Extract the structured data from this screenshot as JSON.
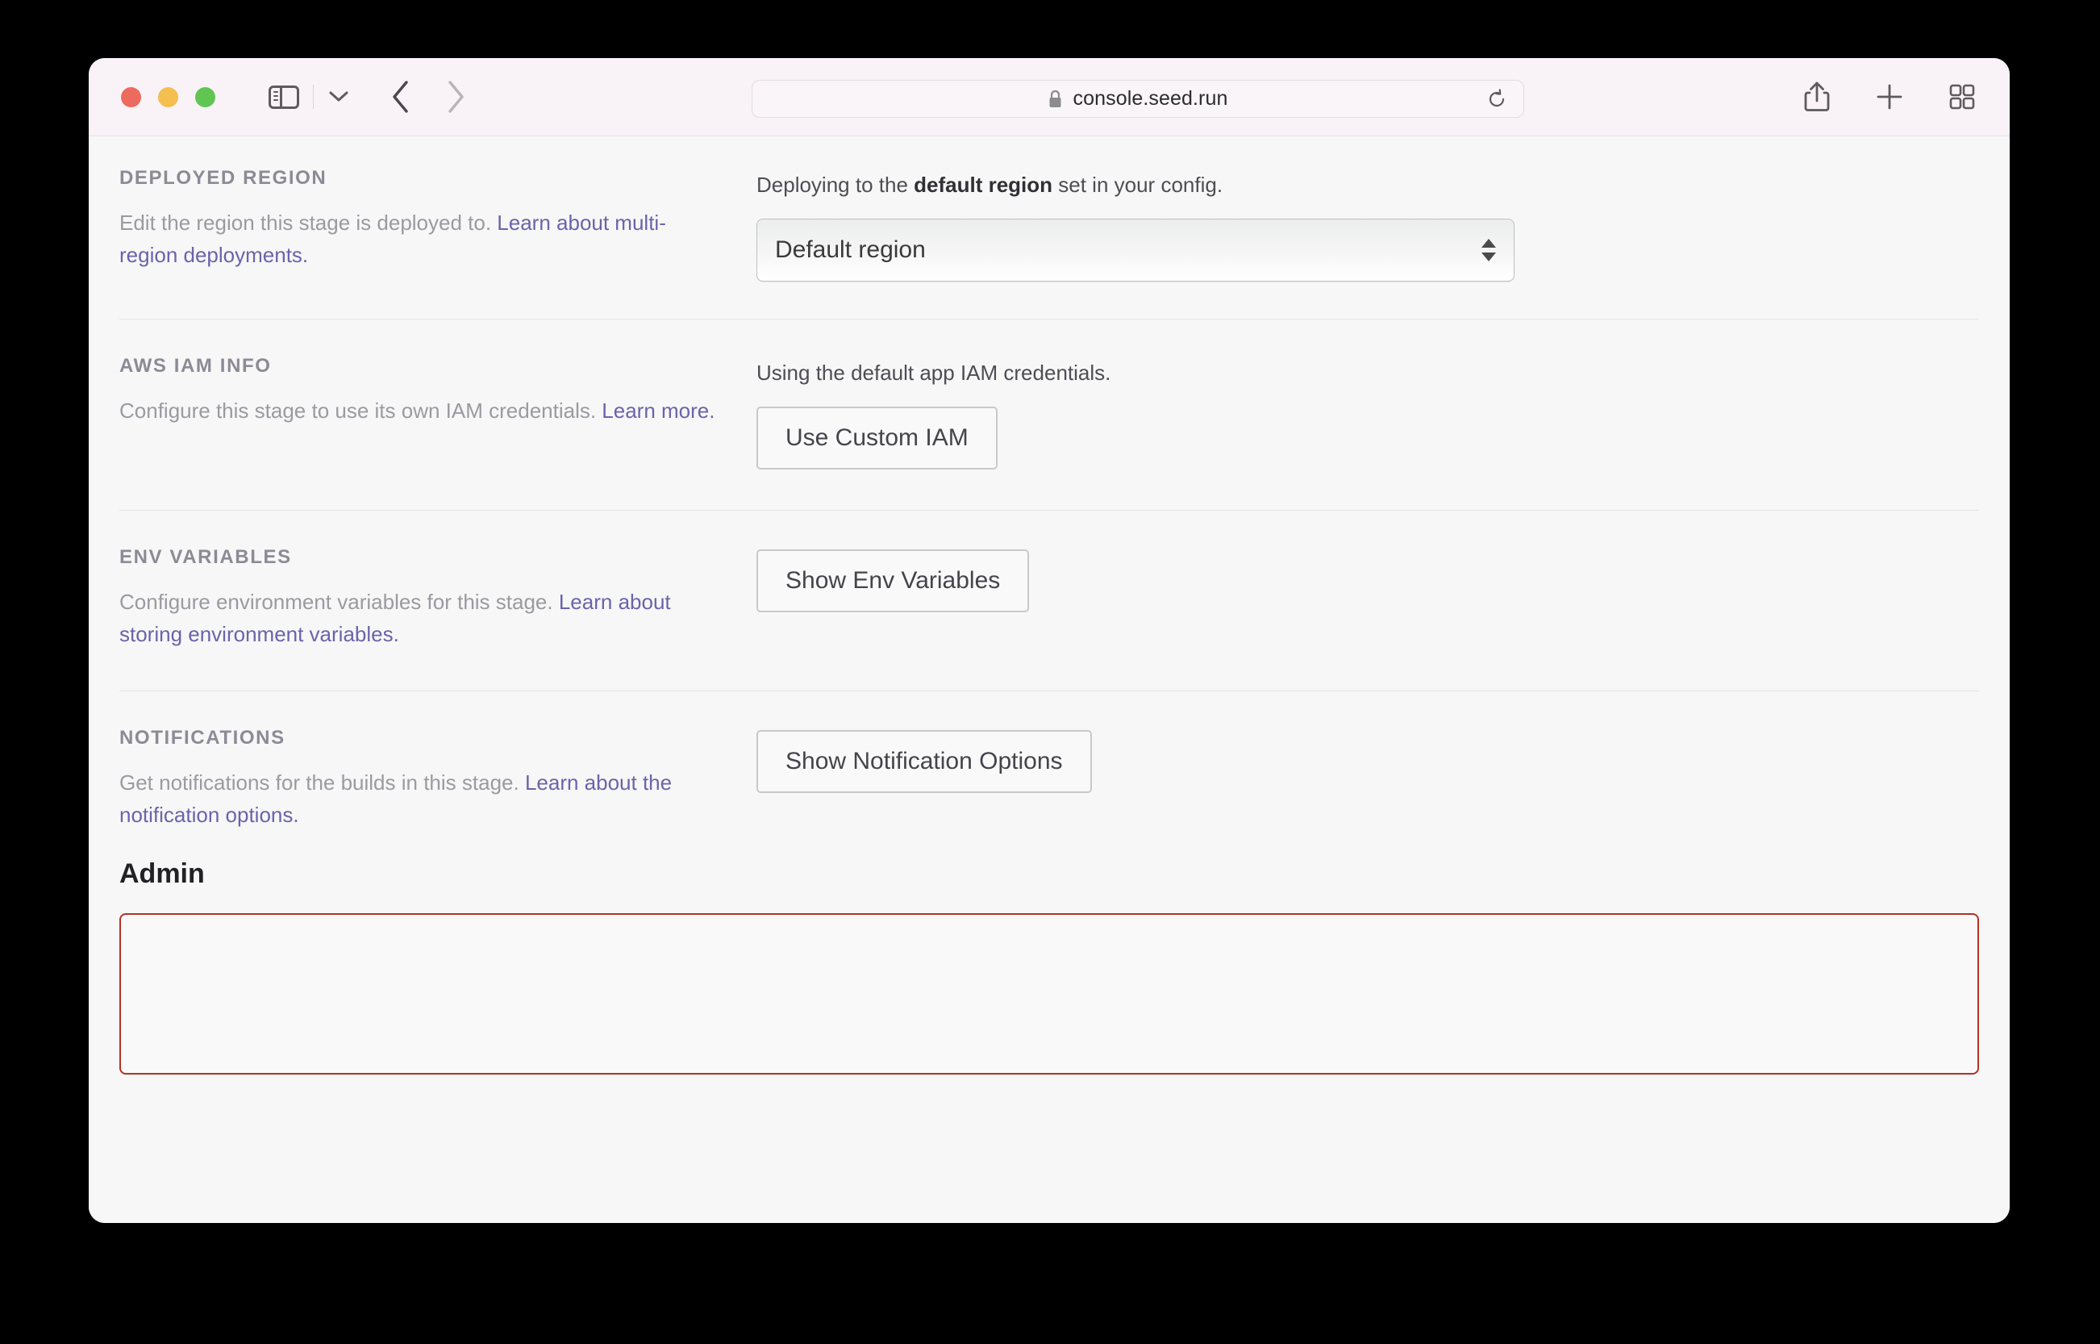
{
  "browser": {
    "url": "console.seed.run",
    "lock_icon": "lock-icon",
    "reload_icon": "reload-icon",
    "sidebar_icon": "sidebar-toggle-icon",
    "chevron_icon": "chevron-down-icon",
    "back_icon": "back-chevron-icon",
    "forward_icon": "forward-chevron-icon",
    "share_icon": "share-icon",
    "new_tab_icon": "plus-icon",
    "tab_overview_icon": "tab-overview-icon",
    "traffic_lights": [
      "close-red",
      "minimize-yellow",
      "maximize-green"
    ]
  },
  "colors": {
    "link": "#6b63ab",
    "section_title": "#8d8a96",
    "body_bg": "#f7f7f7",
    "toolbar_bg": "#f9f3f7",
    "danger_border": "#b33225",
    "traffic_red": "#ed6a5e",
    "traffic_yellow": "#f4bf4f",
    "traffic_green": "#61c554"
  },
  "sections": [
    {
      "title": "DEPLOYED REGION",
      "desc_plain": "Edit the region this stage is deployed to. ",
      "desc_link": "Learn about multi-region deployments.",
      "right_note_pre": "Deploying to the ",
      "right_note_bold": "default region",
      "right_note_post": " set in your config.",
      "control": "select",
      "select_value": "Default region"
    },
    {
      "title": "AWS IAM INFO",
      "desc_plain": "Configure this stage to use its own IAM credentials. ",
      "desc_link": "Learn more.",
      "right_note_pre": "Using the default app IAM credentials.",
      "right_note_bold": "",
      "right_note_post": "",
      "control": "button",
      "button_label": "Use Custom IAM"
    },
    {
      "title": "ENV VARIABLES",
      "desc_plain": "Configure environment variables for this stage. ",
      "desc_link": "Learn about storing environment variables.",
      "right_note_pre": "",
      "right_note_bold": "",
      "right_note_post": "",
      "control": "button",
      "button_label": "Show Env Variables"
    },
    {
      "title": "NOTIFICATIONS",
      "desc_plain": "Get notifications for the builds in this stage. ",
      "desc_link": "Learn about the notification options.",
      "right_note_pre": "",
      "right_note_bold": "",
      "right_note_post": "",
      "control": "button",
      "button_label": "Show Notification Options"
    }
  ],
  "admin": {
    "title": "Admin"
  }
}
